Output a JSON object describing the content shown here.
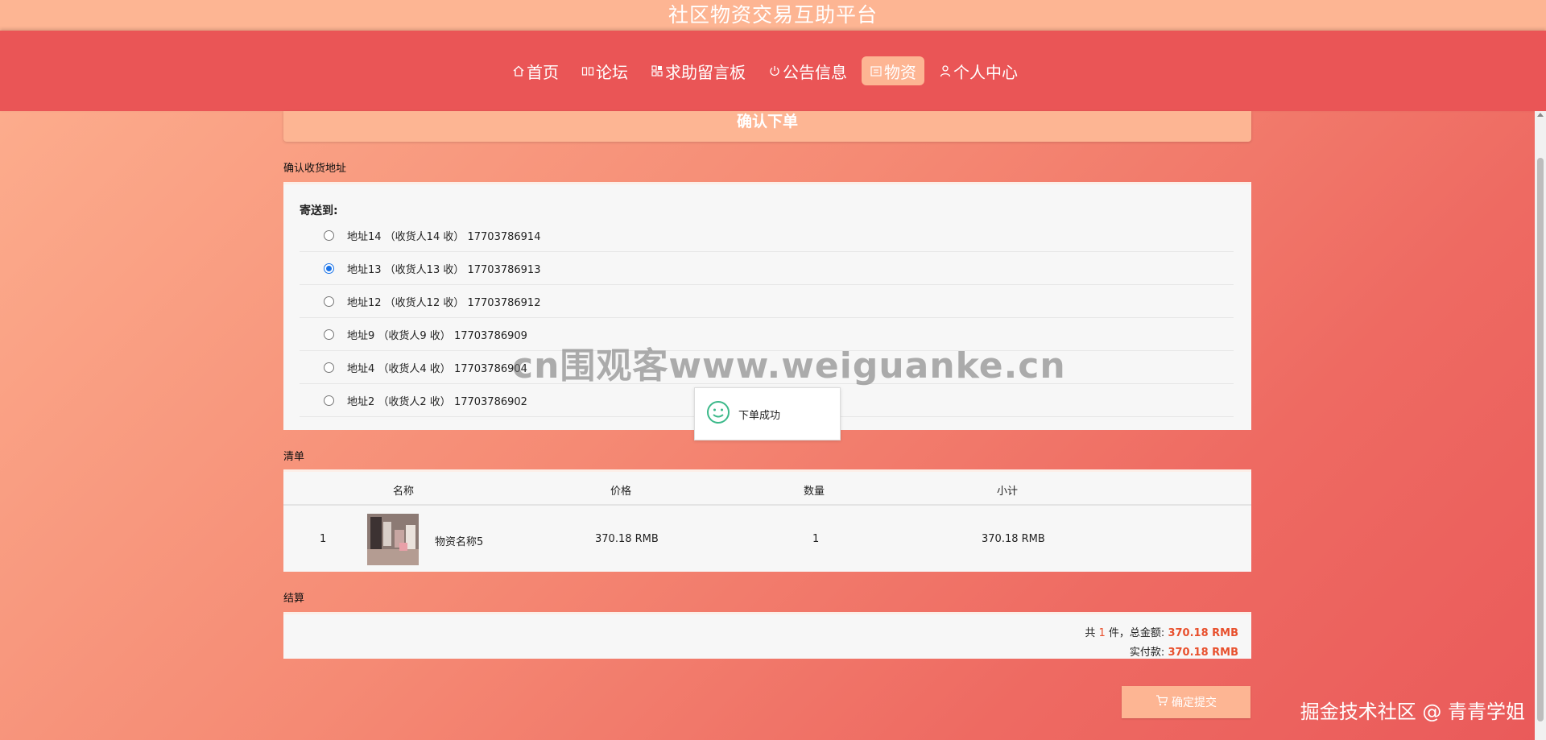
{
  "header": {
    "title": "社区物资交易互助平台"
  },
  "nav": [
    {
      "label": "首页",
      "icon": "home-icon",
      "active": false
    },
    {
      "label": "论坛",
      "icon": "book-icon",
      "active": false
    },
    {
      "label": "求助留言板",
      "icon": "apps-icon",
      "active": false
    },
    {
      "label": "公告信息",
      "icon": "power-icon",
      "active": false
    },
    {
      "label": "物资",
      "icon": "box-icon",
      "active": true
    },
    {
      "label": "个人中心",
      "icon": "user-icon",
      "active": false
    }
  ],
  "order": {
    "header": "确认下单",
    "address_section_title": "确认收货地址",
    "send_to_label": "寄送到:",
    "addresses": [
      {
        "text": "地址14 （收货人14 收） 17703786914",
        "checked": false
      },
      {
        "text": "地址13 （收货人13 收） 17703786913",
        "checked": true
      },
      {
        "text": "地址12 （收货人12 收） 17703786912",
        "checked": false
      },
      {
        "text": "地址9 （收货人9 收） 17703786909",
        "checked": false
      },
      {
        "text": "地址4 （收货人4 收） 17703786904",
        "checked": false
      },
      {
        "text": "地址2 （收货人2 收） 17703786902",
        "checked": false
      }
    ],
    "list_section_title": "清单",
    "list_columns": {
      "name": "名称",
      "price": "价格",
      "qty": "数量",
      "subtotal": "小计"
    },
    "items": [
      {
        "index": "1",
        "name": "物资名称5",
        "price": "370.18 RMB",
        "qty": "1",
        "subtotal": "370.18 RMB"
      }
    ],
    "settle_section_title": "结算",
    "settle": {
      "count_prefix": "共",
      "count": "1",
      "count_suffix": "件，总金额:",
      "total": "370.18 RMB",
      "paid_label": "实付款:",
      "paid": "370.18 RMB"
    },
    "submit_label": "确定提交"
  },
  "toast": {
    "message": "下单成功"
  },
  "watermarks": {
    "center": "cn围观客www.weiguanke.cn",
    "corner": "掘金技术社区 @ 青青学姐"
  },
  "colors": {
    "accent": "#fdb593",
    "nav_bg": "#ea5556",
    "price_red": "#e8502d",
    "radio_checked": "#1a73e8"
  }
}
